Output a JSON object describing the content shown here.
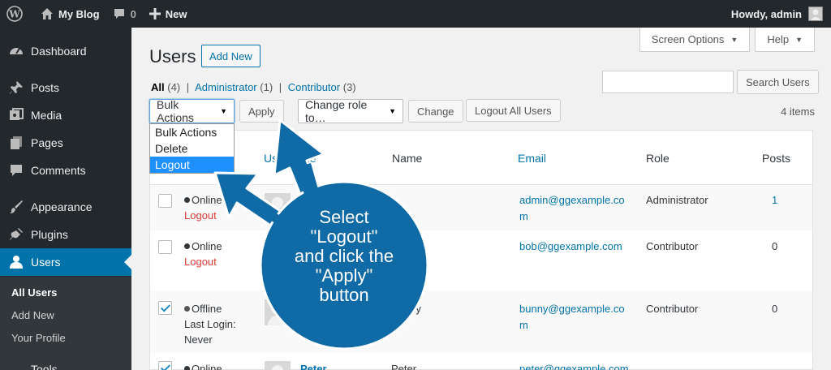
{
  "adminbar": {
    "site_name": "My Blog",
    "comments_count": "0",
    "new_label": "New",
    "howdy": "Howdy, admin"
  },
  "sidebar": {
    "items": [
      {
        "label": "Dashboard",
        "icon": "dashboard-icon"
      },
      {
        "label": "Posts",
        "icon": "pin-icon"
      },
      {
        "label": "Media",
        "icon": "media-icon"
      },
      {
        "label": "Pages",
        "icon": "pages-icon"
      },
      {
        "label": "Comments",
        "icon": "comment-icon"
      },
      {
        "label": "Appearance",
        "icon": "brush-icon"
      },
      {
        "label": "Plugins",
        "icon": "plug-icon"
      },
      {
        "label": "Users",
        "icon": "user-icon"
      }
    ],
    "submenu": [
      "All Users",
      "Add New",
      "Your Profile"
    ],
    "next_partial": "Tools"
  },
  "screen_options": "Screen Options",
  "help": "Help",
  "page": {
    "title": "Users",
    "add_new": "Add New"
  },
  "views": {
    "all": "All",
    "all_count": "(4)",
    "administrator": "Administrator",
    "administrator_count": "(1)",
    "contributor": "Contributor",
    "contributor_count": "(3)",
    "sep": "|"
  },
  "search": {
    "button": "Search Users",
    "placeholder": ""
  },
  "bulk": {
    "selected": "Bulk Actions",
    "options": [
      "Bulk Actions",
      "Delete",
      "Logout"
    ],
    "apply": "Apply",
    "change_role": "Change role to…",
    "change": "Change",
    "logout_all": "Logout All Users"
  },
  "items_count": "4 items",
  "table": {
    "headers": {
      "username": "Username",
      "name": "Name",
      "email": "Email",
      "role": "Role",
      "posts": "Posts"
    },
    "rows": [
      {
        "status": "Online",
        "action": "Logout",
        "email": "admin@ggexample.com",
        "role": "Administrator",
        "posts": "1",
        "checked": false
      },
      {
        "status": "Online",
        "action": "Logout",
        "email": "bob@ggexample.com",
        "role": "Contributor",
        "posts": "0",
        "checked": false
      },
      {
        "status": "Offline",
        "action": "Last Login:",
        "action2": "Never",
        "name": "Bunny",
        "email": "bunny@ggexample.com",
        "role": "Contributor",
        "posts": "0",
        "checked": true
      },
      {
        "status": "Online",
        "username": "Peter",
        "name": "Peter",
        "email": "peter@ggexample.com",
        "checked": true
      }
    ]
  },
  "callout": {
    "lines": [
      "Select",
      "\"Logout\"",
      "and click the",
      "\"Apply\"",
      "button"
    ],
    "color": "#0f6aa5"
  }
}
